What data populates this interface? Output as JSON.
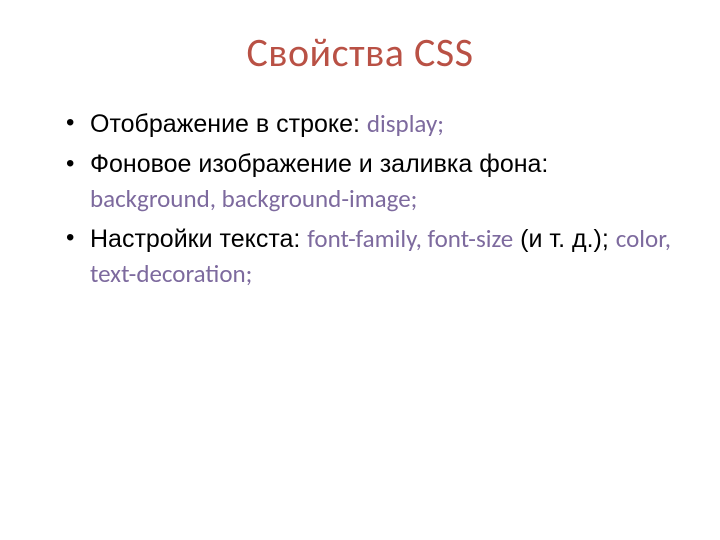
{
  "title": "Свойства CSS",
  "items": [
    {
      "label": "Отображение в строке: ",
      "code": "display;"
    },
    {
      "label": "Фоновое изображение и заливка фона: ",
      "code": "background, background-image;"
    },
    {
      "label": "Настройки текста: ",
      "code1": "font-family, font-size",
      "mid": " (и т. д.); ",
      "code2": "color, text-decoration;"
    }
  ]
}
